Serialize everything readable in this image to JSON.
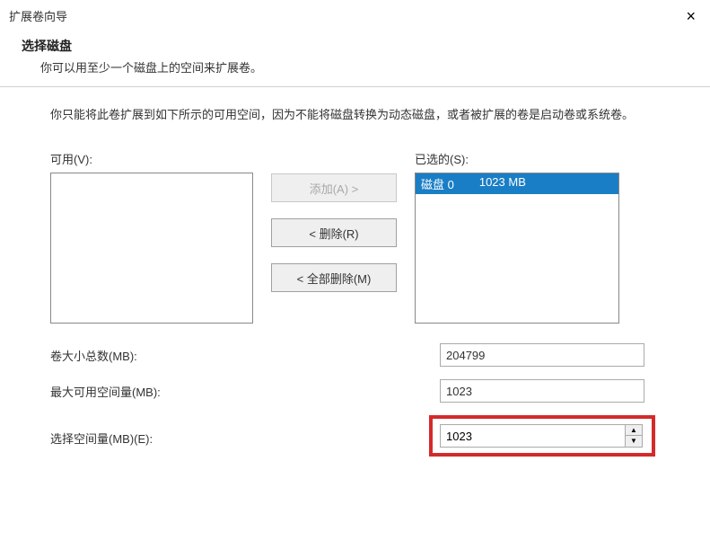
{
  "window": {
    "title": "扩展卷向导",
    "close": "×"
  },
  "subheader": {
    "heading": "选择磁盘",
    "description": "你可以用至少一个磁盘上的空间来扩展卷。"
  },
  "content": {
    "description": "你只能将此卷扩展到如下所示的可用空间，因为不能将磁盘转换为动态磁盘，或者被扩展的卷是启动卷或系统卷。"
  },
  "lists": {
    "available_label": "可用(V):",
    "selected_label": "已选的(S):",
    "available_items": [],
    "selected_items": [
      {
        "disk": "磁盘 0",
        "size": "1023 MB"
      }
    ]
  },
  "buttons": {
    "add": "添加(A) >",
    "remove": "< 删除(R)",
    "remove_all": "< 全部删除(M)"
  },
  "fields": {
    "total_label": "卷大小总数(MB):",
    "total_value": "204799",
    "max_label": "最大可用空间量(MB):",
    "max_value": "1023",
    "select_label": "选择空间量(MB)(E):",
    "select_value": "1023"
  }
}
